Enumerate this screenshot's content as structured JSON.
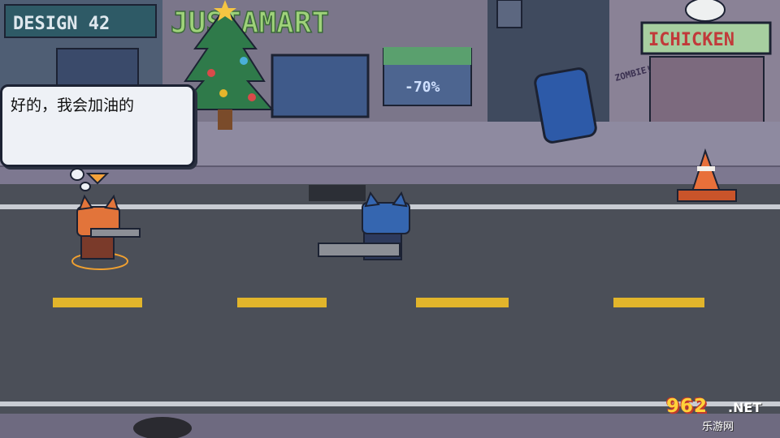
{
  "signs": {
    "design": "DESIGN 42",
    "mart": "JUSTAMART",
    "discount": "-70%",
    "chicken": "ICHICKEN",
    "graffiti": "ZOMBIE!"
  },
  "dialogue": {
    "text": "好的，我会加油的"
  },
  "watermark": {
    "number": "962",
    "domain": ".NET",
    "site": "乐游网"
  },
  "colors": {
    "road": "#4b4f58",
    "sidewalk": "#8e8aa0",
    "lane_marking": "#e2b52b",
    "bubble": "#eef1f6"
  },
  "characters": [
    {
      "name": "orange-cat",
      "icon": "cat-with-rifle-icon"
    },
    {
      "name": "blue-cat",
      "icon": "cat-with-minigun-icon"
    }
  ]
}
